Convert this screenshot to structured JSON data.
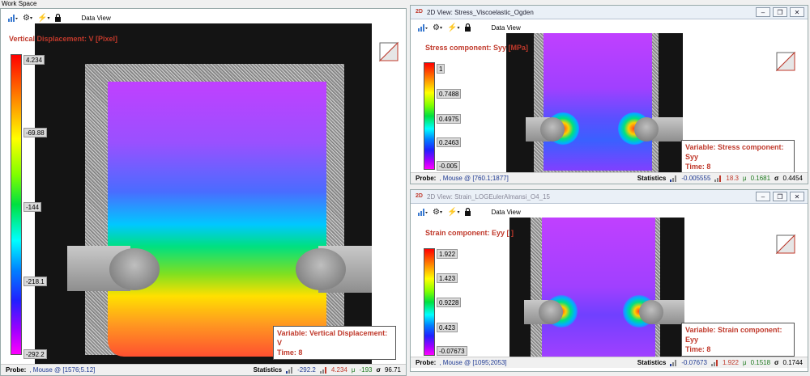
{
  "workspace": {
    "title": "Work Space"
  },
  "toolbar": {
    "data_view": "Data View"
  },
  "left_panel": {
    "var_title": "Vertical Displacement: V [Pixel]",
    "ticks": [
      "4.234",
      "-69.88",
      "-144",
      "-218.1",
      "-292.2"
    ],
    "variable_label": "Variable: Vertical Displacement: V",
    "time_label": "Time: 8",
    "probe_label": "Probe:",
    "probe_text": ", Mouse @ [1576;5.12]",
    "stats_label": "Statistics",
    "stat_min": "-292.2",
    "stat_max": "4.234",
    "stat_mean": "-193",
    "stat_sigma": "96.71"
  },
  "stress_window": {
    "title": "2D View: Stress_Viscoelastic_Ogden",
    "var_title": "Stress component: Syy [MPa]",
    "ticks": [
      "1",
      "0.7488",
      "0.4975",
      "0.2463",
      "-0.005"
    ],
    "variable_label": "Variable: Stress component: Syy",
    "time_label": "Time: 8",
    "probe_label": "Probe:",
    "probe_text": ", Mouse @ [760.1;1877]",
    "stats_label": "Statistics",
    "stat_min": "-0.005555",
    "stat_max": "18.3",
    "stat_mean": "0.1681",
    "stat_sigma": "0.4454"
  },
  "strain_window": {
    "title": "2D View: Strain_LOGEulerAlmansi_O4_15",
    "var_title": "Strain component: Eyy [ ]",
    "ticks": [
      "1.922",
      "1.423",
      "0.9228",
      "0.423",
      "-0.07673"
    ],
    "variable_label": "Variable: Strain component: Eyy",
    "time_label": "Time: 8",
    "probe_label": "Probe:",
    "probe_text": ", Mouse @ [1095;2053]",
    "stats_label": "Statistics",
    "stat_min": "-0.07673",
    "stat_max": "1.922",
    "stat_mean": "0.1518",
    "stat_sigma": "0.1744"
  },
  "icons": {
    "chart": "bar-chart-icon",
    "gear": "gear-icon",
    "lightning": "lightning-icon",
    "lock": "lock-icon",
    "minimize": "minimize-icon",
    "restore": "restore-icon",
    "close": "close-icon",
    "sigma": "σ",
    "mu": "μ"
  },
  "colors": {
    "accent_text": "#c0392b",
    "probe_text": "#1f3a93"
  }
}
